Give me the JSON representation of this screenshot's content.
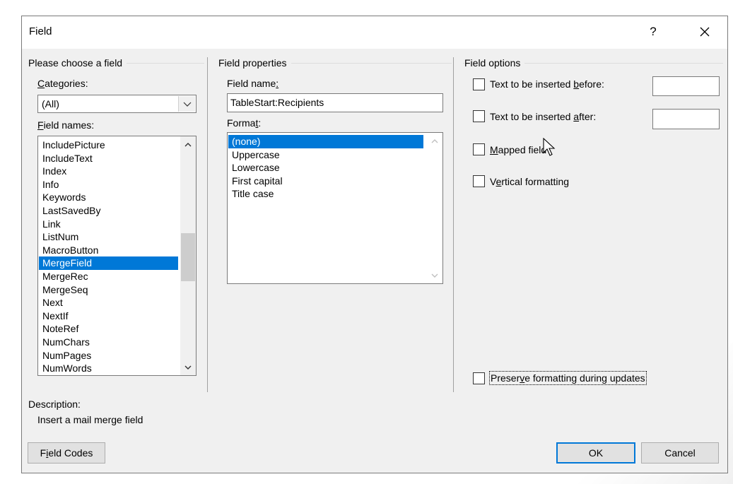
{
  "dialog": {
    "title": "Field",
    "help_label": "?"
  },
  "choose": {
    "group_label": "Please choose a field",
    "categories_label_key": "C",
    "categories_label_rest": "ategories:",
    "categories_value": "(All)",
    "field_names_label_key": "F",
    "field_names_label_rest": "ield names:",
    "field_names": [
      "IncludePicture",
      "IncludeText",
      "Index",
      "Info",
      "Keywords",
      "LastSavedBy",
      "Link",
      "ListNum",
      "MacroButton",
      "MergeField",
      "MergeRec",
      "MergeSeq",
      "Next",
      "NextIf",
      "NoteRef",
      "NumChars",
      "NumPages",
      "NumWords"
    ],
    "selected_field": "MergeField"
  },
  "properties": {
    "group_label": "Field properties",
    "field_name_label_pre": "Field name",
    "field_name_label_key": ":",
    "field_name_value": "TableStart:Recipients",
    "format_label_pre": "Forma",
    "format_label_key": "t",
    "format_label_post": ":",
    "formats": [
      "(none)",
      "Uppercase",
      "Lowercase",
      "First capital",
      "Title case"
    ],
    "selected_format": "(none)"
  },
  "options": {
    "group_label": "Field options",
    "before_pre": "Text to be inserted ",
    "before_key": "b",
    "before_post": "efore:",
    "after_pre": "Text to be inserted ",
    "after_key": "a",
    "after_post": "fter:",
    "mapped_key": "M",
    "mapped_post": "apped field",
    "vertical_pre": "V",
    "vertical_key": "e",
    "vertical_post": "rtical formatting",
    "preserve_pre": "Preser",
    "preserve_key": "v",
    "preserve_post": "e formatting during updates",
    "before_checked": false,
    "after_checked": false,
    "mapped_checked": false,
    "vertical_checked": false,
    "preserve_checked": false
  },
  "description": {
    "label": "Description:",
    "text": "Insert a mail merge field"
  },
  "buttons": {
    "field_codes_key": "i",
    "field_codes_pre": "F",
    "field_codes_post": "eld Codes",
    "ok": "OK",
    "cancel": "Cancel"
  },
  "colors": {
    "selection": "#0078d7",
    "dialog_bg": "#f0f0f0"
  }
}
